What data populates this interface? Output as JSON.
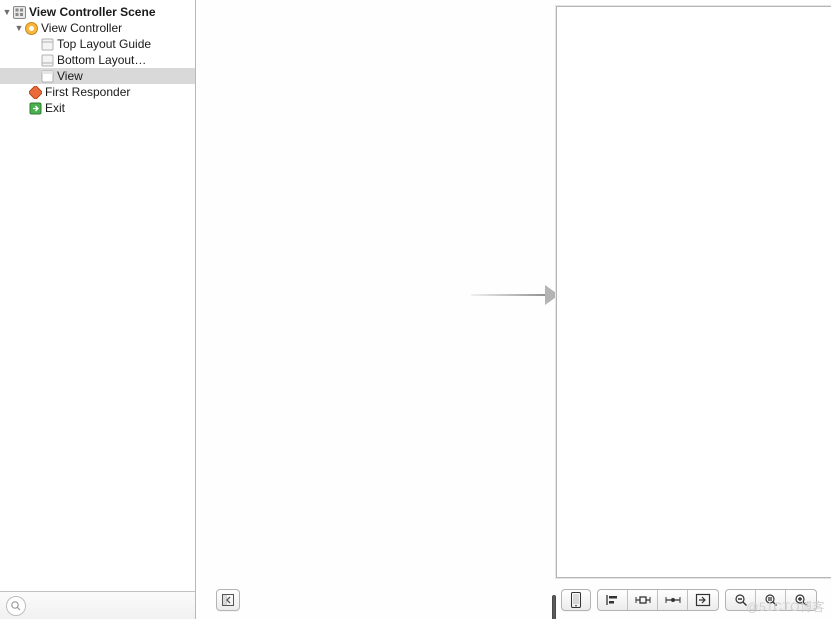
{
  "outline": {
    "scene": "View Controller Scene",
    "items": [
      {
        "label": "View Controller"
      },
      {
        "label": "Top Layout Guide"
      },
      {
        "label": "Bottom Layout…"
      },
      {
        "label": "View"
      },
      {
        "label": "First Responder"
      },
      {
        "label": "Exit"
      }
    ]
  },
  "toolbar": {
    "collapse": "◀",
    "device": "▮",
    "align_left": "align-left",
    "pin": "pin",
    "resolve": "resolve",
    "embed": "embed",
    "zoom_out": "−",
    "zoom_actual": "=",
    "zoom_in": "+"
  },
  "watermark": "@51CTO博客"
}
